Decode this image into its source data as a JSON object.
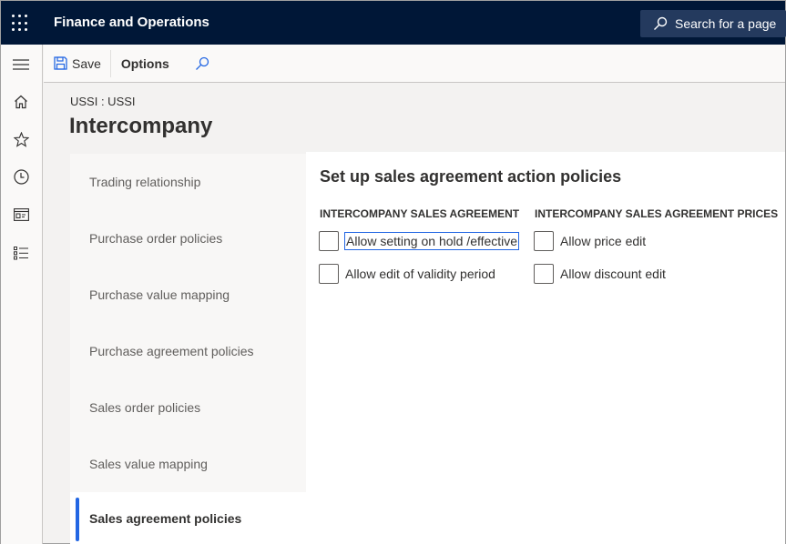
{
  "app": {
    "title": "Finance and Operations",
    "search_placeholder": "Search for a page"
  },
  "nav": {
    "items": [
      {
        "name": "menu",
        "icon": "hamburger-icon"
      },
      {
        "name": "home",
        "icon": "home-icon"
      },
      {
        "name": "favorites",
        "icon": "star-icon"
      },
      {
        "name": "recent",
        "icon": "clock-icon"
      },
      {
        "name": "workspaces",
        "icon": "workspace-icon"
      },
      {
        "name": "modules",
        "icon": "list-icon"
      }
    ]
  },
  "toolbar": {
    "save_label": "Save",
    "options_label": "Options"
  },
  "page": {
    "breadcrumb": "USSI : USSI",
    "title": "Intercompany"
  },
  "tabs": [
    {
      "label": "Trading relationship",
      "active": false
    },
    {
      "label": "Purchase order policies",
      "active": false
    },
    {
      "label": "Purchase value mapping",
      "active": false
    },
    {
      "label": "Purchase agreement policies",
      "active": false
    },
    {
      "label": "Sales order policies",
      "active": false
    },
    {
      "label": "Sales value mapping",
      "active": false
    },
    {
      "label": "Sales agreement policies",
      "active": true
    }
  ],
  "content": {
    "section_title": "Set up sales agreement action policies",
    "groups": [
      {
        "header": "INTERCOMPANY SALES AGREEMENT",
        "options": [
          {
            "label": "Allow setting on hold /effective",
            "checked": false,
            "focused": true
          },
          {
            "label": "Allow edit of validity period",
            "checked": false,
            "focused": false
          }
        ]
      },
      {
        "header": "INTERCOMPANY SALES AGREEMENT PRICES",
        "options": [
          {
            "label": "Allow price edit",
            "checked": false,
            "focused": false
          },
          {
            "label": "Allow discount edit",
            "checked": false,
            "focused": false
          }
        ]
      }
    ]
  },
  "colors": {
    "topbar": "#001737",
    "search_box": "#243a5e",
    "accent": "#2266e3"
  }
}
